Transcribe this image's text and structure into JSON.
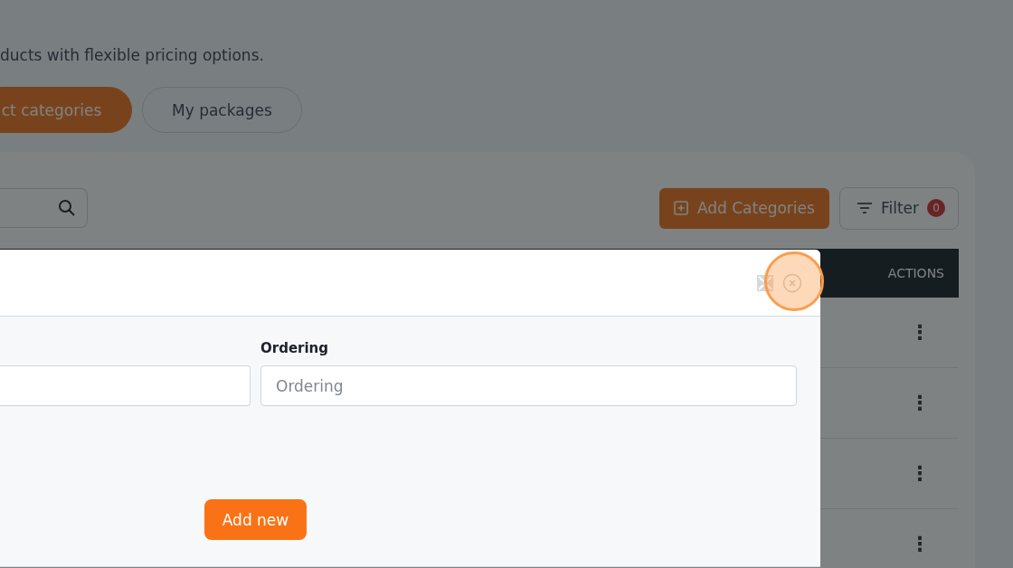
{
  "page": {
    "subtitle": "ducts with flexible pricing options."
  },
  "tabs": [
    {
      "label": "ct categories",
      "selected": true
    },
    {
      "label": "My packages",
      "selected": false
    }
  ],
  "toolbar": {
    "add_button": "Add Categories",
    "filter_button": "Filter",
    "filter_count": "0"
  },
  "table": {
    "columns": [
      "ACTIONS"
    ],
    "rows": [
      {
        "menu": "⋮"
      },
      {
        "menu": "⋮"
      },
      {
        "menu": "⋮"
      },
      {
        "menu": "⋮"
      }
    ]
  },
  "modal": {
    "close_highlighted": true,
    "fields": [
      {
        "label": "Ordering",
        "placeholder": "Ordering"
      }
    ],
    "submit": "Add new"
  }
}
